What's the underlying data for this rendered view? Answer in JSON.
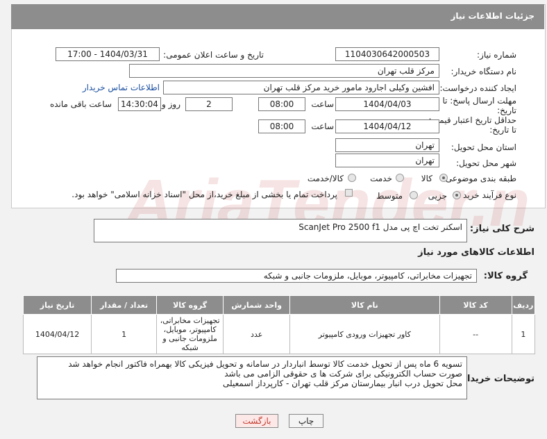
{
  "header": {
    "title": "جزئیات اطلاعات نیاز"
  },
  "form": {
    "need_number_label": "شماره نیاز:",
    "need_number": "1104030642000503",
    "announce_label": "تاریخ و ساعت اعلان عمومی:",
    "announce_value": "1404/03/31 - 17:00",
    "buyer_org_label": "نام دستگاه خریدار:",
    "buyer_org": "مرکز قلب تهران",
    "requester_label": "ایجاد کننده درخواست:",
    "requester": "افشین وکیلی اجارود مامور خرید مرکز قلب تهران",
    "contact_link": "اطلاعات تماس خریدار",
    "deadline_label": "مهلت ارسال پاسخ: تا تاریخ:",
    "deadline_date": "1404/04/03",
    "time_label": "ساعت",
    "deadline_time": "08:00",
    "days_value": "2",
    "days_label": "روز و",
    "remaining_time": "14:30:04",
    "remaining_label": "ساعت باقی مانده",
    "price_valid_label": "حداقل تاریخ اعتبار قیمت: تا تاریخ:",
    "price_valid_date": "1404/04/12",
    "price_valid_time": "08:00",
    "province_label": "استان محل تحویل:",
    "province": "تهران",
    "city_label": "شهر محل تحویل:",
    "city": "تهران",
    "category_label": "طبقه بندی موضوعی:",
    "category_options": [
      "کالا",
      "خدمت",
      "کالا/خدمت"
    ],
    "process_label": "نوع فرآیند خرید :",
    "process_options": [
      "جزیی",
      "متوسط"
    ],
    "payment_note": "پرداخت تمام یا بخشی از مبلغ خرید،از محل \"اسناد خزانه اسلامی\" خواهد بود."
  },
  "description": {
    "label": "شرح کلی نیاز:",
    "value": "اسکنر تخت اچ پی مدل ScanJet Pro 2500 f1"
  },
  "goods_info_title": "اطلاعات کالاهای مورد نیاز",
  "goods_group": {
    "label": "گروه کالا:",
    "value": "تجهیزات مخابراتی، کامپیوتر، موبایل، ملزومات جانبی و شبکه"
  },
  "table": {
    "headers": [
      "ردیف",
      "کد کالا",
      "نام کالا",
      "واحد شمارش",
      "گروه کالا",
      "تعداد / مقدار",
      "تاریخ نیاز"
    ],
    "rows": [
      [
        "1",
        "--",
        "کاور تجهیزات ورودی کامپیوتر",
        "عدد",
        "تجهیزات مخابراتی، کامپیوتر، موبایل، ملزومات جانبی و شبکه",
        "1",
        "1404/04/12"
      ]
    ]
  },
  "buyer_notes": {
    "label": "توضیحات خریدار:",
    "lines": [
      "تسویه 6 ماه پس از تحویل خدمت کالا توسط انباردار در سامانه و تحویل فیزیکی کالا بهمراه فاکتور انجام خواهد شد",
      "صورت حساب الکترونیکی برای شرکت ها ی حقوقی الزامی می باشد",
      "محل تحویل درب انبار بیمارستان مرکز قلب تهران - کارپرداز اسمعیلی"
    ]
  },
  "buttons": {
    "print": "چاپ",
    "back": "بازگشت"
  },
  "colors": {
    "header_bg": "#8d8d8d",
    "link": "#1a4fa0",
    "back_text": "#c0392b"
  }
}
